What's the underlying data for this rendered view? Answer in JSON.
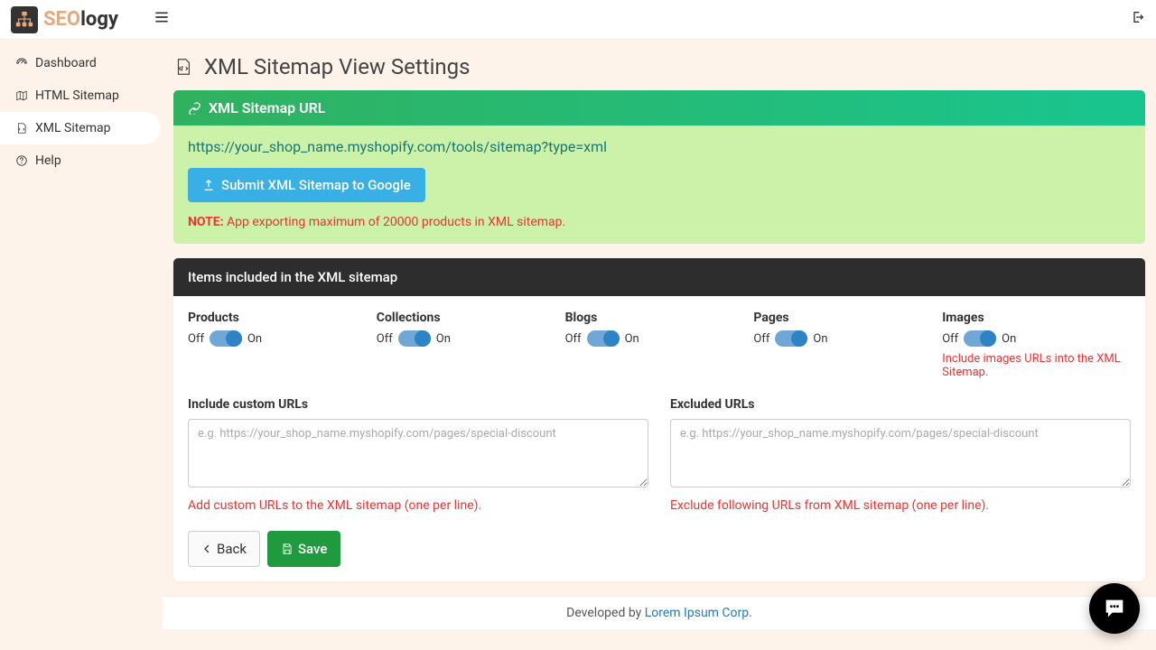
{
  "brand": {
    "seo": "SEO",
    "logy": "logy"
  },
  "sidebar": {
    "items": [
      {
        "label": "Dashboard"
      },
      {
        "label": "HTML Sitemap"
      },
      {
        "label": "XML Sitemap"
      },
      {
        "label": "Help"
      }
    ]
  },
  "page": {
    "title": "XML Sitemap View Settings"
  },
  "url_panel": {
    "header": "XML Sitemap URL",
    "url": "https://your_shop_name.myshopify.com/tools/sitemap?type=xml",
    "submit_label": "Submit XML Sitemap to Google",
    "note_prefix": "NOTE:",
    "note_text": " App exporting maximum of 20000 products in XML sitemap."
  },
  "items_panel": {
    "header": "Items included in the XML sitemap",
    "off": "Off",
    "on": "On",
    "toggles": [
      {
        "label": "Products",
        "value": "on"
      },
      {
        "label": "Collections",
        "value": "on"
      },
      {
        "label": "Blogs",
        "value": "on"
      },
      {
        "label": "Pages",
        "value": "on"
      },
      {
        "label": "Images",
        "value": "on",
        "help": "Include images URLs into the XML Sitemap."
      }
    ],
    "include": {
      "label": "Include custom URLs",
      "placeholder": "e.g. https://your_shop_name.myshopify.com/pages/special-discount",
      "help": "Add custom URLs to the XML sitemap (one per line)."
    },
    "exclude": {
      "label": "Excluded URLs",
      "placeholder": "e.g. https://your_shop_name.myshopify.com/pages/special-discount",
      "help": "Exclude following URLs from XML sitemap (one per line)."
    },
    "back_label": "Back",
    "save_label": "Save"
  },
  "footer": {
    "prefix": "Developed by ",
    "link": "Lorem Ipsum Corp",
    "suffix": "."
  }
}
